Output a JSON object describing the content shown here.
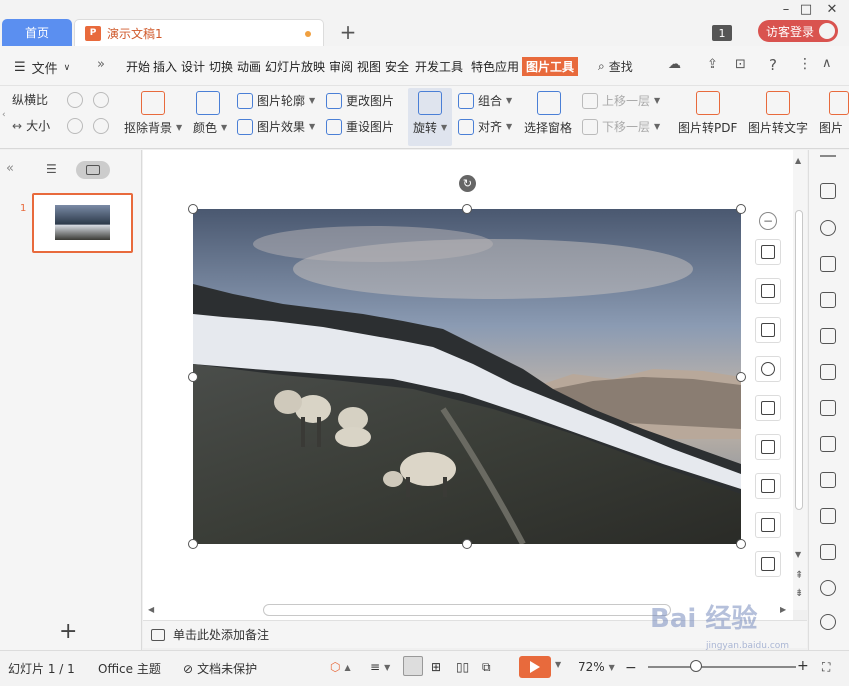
{
  "titlebar": {
    "home_tab": "首页",
    "doc_tab": "演示文稿1",
    "doc_icon": "P",
    "new_tab": "+",
    "badge": "1",
    "login": "访客登录"
  },
  "menubar": {
    "file": "文件",
    "items": [
      "开始",
      "插入",
      "设计",
      "切换",
      "动画",
      "幻灯片放映",
      "审阅",
      "视图",
      "安全",
      "开发工具",
      "特色应用",
      "图片工具"
    ],
    "active_item": "图片工具",
    "search": "查找"
  },
  "ribbon": {
    "lock_ratio": "纵横比",
    "resize": "大小",
    "remove_bg": "抠除背景",
    "color": "颜色",
    "outline": "图片轮廓",
    "effect": "图片效果",
    "change_pic": "更改图片",
    "reset_pic": "重设图片",
    "rotate": "旋转",
    "group": "组合",
    "align": "对齐",
    "select_pane": "选择窗格",
    "bring_forward": "上移一层",
    "send_backward": "下移一层",
    "to_pdf": "图片转PDF",
    "to_text": "图片转文字",
    "more": "图片"
  },
  "leftpanel": {
    "slide_number": "1",
    "add_slide": "+"
  },
  "notes": {
    "placeholder": "单击此处添加备注"
  },
  "statusbar": {
    "slide_info": "幻灯片 1 / 1",
    "theme": "Office 主题",
    "protect": "文档未保护",
    "zoom": "72%"
  },
  "watermark": {
    "text": "Bai 经验",
    "sub": "jingyan.baidu.com"
  },
  "colors": {
    "accent": "#e86a3c",
    "home_tab": "#5b8ff0",
    "login": "#d9534f"
  }
}
